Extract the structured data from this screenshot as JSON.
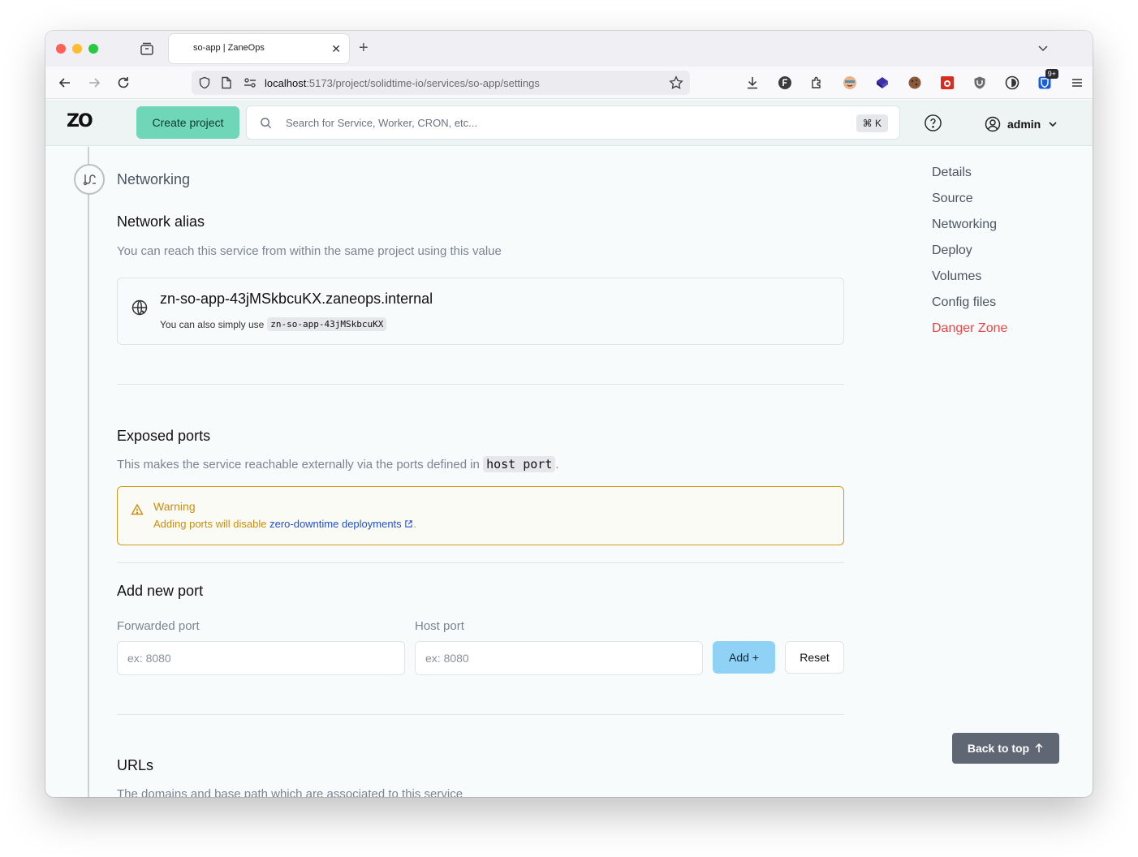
{
  "browser": {
    "tab_title": "so-app | ZaneOps",
    "tab_close": "✕",
    "new_tab": "+",
    "url_host": "localhost",
    "url_rest": ":5173/project/solidtime-io/services/so-app/settings",
    "ext_badge": "9+"
  },
  "header": {
    "logo": "ZO",
    "create_project": "Create project",
    "search_placeholder": "Search for Service, Worker, CRON, etc...",
    "search_shortcut": "⌘ K",
    "user_name": "admin"
  },
  "networking": {
    "section_title": "Networking",
    "alias_heading": "Network alias",
    "alias_description": "You can reach this service from within the same project using this value",
    "alias_value": "zn-so-app-43jMSkbcuKX.zaneops.internal",
    "alias_sub_prefix": "You can also simply use",
    "alias_short": "zn-so-app-43jMSkbcuKX",
    "ports_heading": "Exposed ports",
    "ports_description": "This makes the service reachable externally via the ports defined in",
    "ports_code": "host port",
    "ports_period": ".",
    "warning_title": "Warning",
    "warning_prefix": "Adding ports will disable",
    "warning_link": "zero-downtime deployments",
    "warning_suffix": ".",
    "add_port_heading": "Add new port",
    "forwarded_label": "Forwarded port",
    "forwarded_placeholder": "ex: 8080",
    "host_label": "Host port",
    "host_placeholder": "ex: 8080",
    "add_button": "Add +",
    "reset_button": "Reset",
    "urls_heading": "URLs",
    "urls_description": "The domains and base path which are associated to this service"
  },
  "side_nav": {
    "items": [
      "Details",
      "Source",
      "Networking",
      "Deploy",
      "Volumes",
      "Config files"
    ],
    "danger": "Danger Zone"
  },
  "back_to_top": "Back to top",
  "colors": {
    "accent_green": "#6fd6b8",
    "add_button": "#8fd2f5",
    "warning": "#d08c0b",
    "danger": "#ef4444"
  }
}
